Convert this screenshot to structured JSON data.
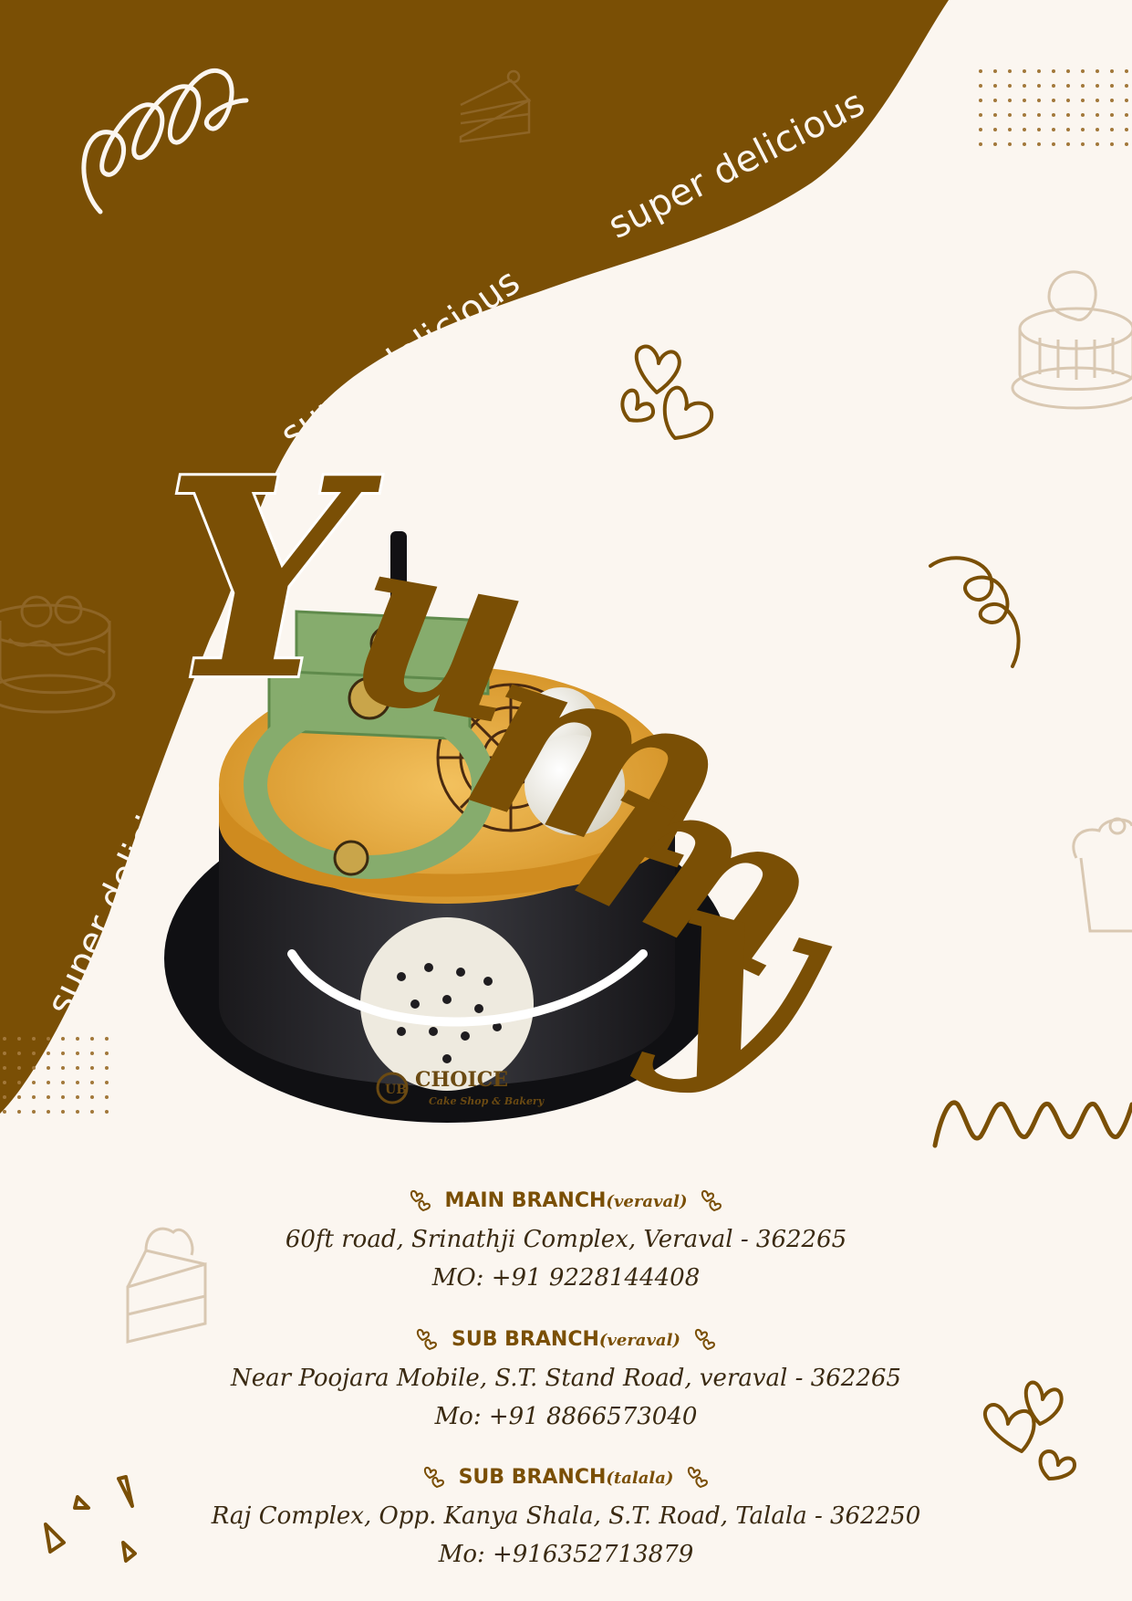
{
  "poster": {
    "taglines": [
      "super delicious",
      "super delicious",
      "super delicious"
    ],
    "headline": "Yummy",
    "cake_logo": {
      "mark": "UB",
      "name": "CHOICE",
      "subtitle": "Cake Shop & Bakery"
    }
  },
  "branches": [
    {
      "title": "MAIN BRANCH",
      "location": "(veraval)",
      "address": "60ft road, Srinathji Complex, Veraval - 362265",
      "phone": "MO: +91 9228144408"
    },
    {
      "title": "SUB BRANCH",
      "location": "(veraval)",
      "address": "Near Poojara Mobile, S.T. Stand Road, veraval - 362265",
      "phone": "Mo: +91 8866573040"
    },
    {
      "title": "SUB BRANCH",
      "location": "(talala)",
      "address": "Raj Complex, Opp. Kanya Shala, S.T. Road, Talala - 362250",
      "phone": "Mo: +916352713879"
    }
  ],
  "colors": {
    "brown": "#7a4f05",
    "cream": "#fbf6f0",
    "green": "#7fa86a",
    "amber": "#e4a431",
    "dark": "#1e1c1f"
  },
  "icons": [
    "squiggle-loop-icon",
    "cake-slice-icon",
    "dot-grid-icon",
    "hearts-icon",
    "spiral-icon",
    "strawberry-cake-icon",
    "cupcake-icon",
    "zigzag-icon",
    "triangles-icon"
  ]
}
